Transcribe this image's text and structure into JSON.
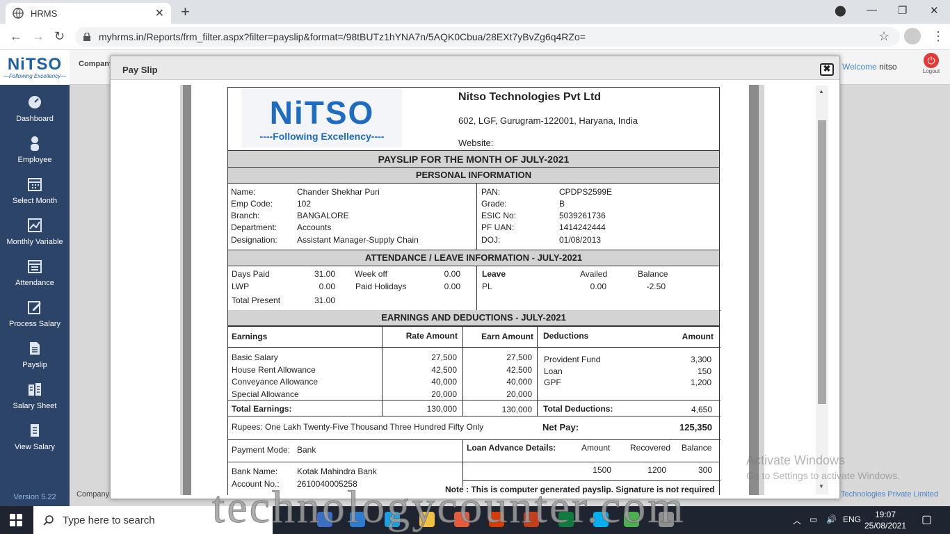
{
  "browser": {
    "tab_title": "HRMS",
    "url": "myhrms.in/Reports/frm_filter.aspx?filter=payslip&format=/98tBUTz1hYNA7n/5AQK0Cbua/28EXt7yBvZg6q4RZo="
  },
  "header": {
    "logo_text": "NiTSO",
    "logo_sub": "—Following Excellency—",
    "company_label": "Company",
    "welcome_label": "Welcome",
    "welcome_user": "nitso",
    "logout_label": "Logout"
  },
  "sidebar": {
    "items": [
      {
        "label": "Dashboard",
        "icon": "dashboard-icon"
      },
      {
        "label": "Employee",
        "icon": "employee-icon"
      },
      {
        "label": "Select Month",
        "icon": "calendar-icon"
      },
      {
        "label": "Monthly Variable",
        "icon": "chart-icon"
      },
      {
        "label": "Attendance",
        "icon": "attendance-icon"
      },
      {
        "label": "Process Salary",
        "icon": "edit-icon"
      },
      {
        "label": "Payslip",
        "icon": "document-icon"
      },
      {
        "label": "Salary Sheet",
        "icon": "sheet-icon"
      },
      {
        "label": "View Salary",
        "icon": "view-icon"
      }
    ],
    "version": "Version 5.22"
  },
  "footer": {
    "left": "Company",
    "right": "o Technologies Private Limited"
  },
  "modal": {
    "title": "Pay Slip",
    "close": "✖"
  },
  "payslip": {
    "logo_text": "NiTSO",
    "logo_sub": "----Following Excellency----",
    "company_name": "Nitso Technologies Pvt Ltd",
    "address": "602, LGF, Gurugram-122001, Haryana, India",
    "website": "Website:",
    "title": "PAYSLIP FOR THE MONTH OF JULY-2021",
    "personal_heading": "PERSONAL INFORMATION",
    "personal_left": [
      {
        "k": "Name:",
        "v": "Chander Shekhar Puri"
      },
      {
        "k": "Emp Code:",
        "v": "102"
      },
      {
        "k": "Branch:",
        "v": "BANGALORE"
      },
      {
        "k": "Department:",
        "v": "Accounts"
      },
      {
        "k": "Designation:",
        "v": "Assistant Manager-Supply Chain"
      }
    ],
    "personal_right": [
      {
        "k": "PAN:",
        "v": "CPDPS2599E"
      },
      {
        "k": "Grade:",
        "v": "B"
      },
      {
        "k": "ESIC No:",
        "v": "5039261736"
      },
      {
        "k": "PF UAN:",
        "v": "1414242444"
      },
      {
        "k": "DOJ:",
        "v": "01/08/2013"
      }
    ],
    "attendance_heading": "ATTENDANCE / LEAVE INFORMATION - JULY-2021",
    "attendance": {
      "days_paid_label": "Days Paid",
      "days_paid": "31.00",
      "week_off_label": "Week off",
      "week_off": "0.00",
      "lwp_label": "LWP",
      "lwp": "0.00",
      "paid_holidays_label": "Paid Holidays",
      "paid_holidays": "0.00",
      "total_present_label": "Total Present",
      "total_present": "31.00"
    },
    "leave": {
      "col_leave": "Leave",
      "col_availed": "Availed",
      "col_balance": "Balance",
      "type": "PL",
      "availed": "0.00",
      "balance": "-2.50"
    },
    "earnings_heading": "EARNINGS AND DEDUCTIONS - JULY-2021",
    "earn_cols": {
      "earnings": "Earnings",
      "rate": "Rate Amount",
      "earn": "Earn Amount",
      "deductions": "Deductions",
      "amount": "Amount"
    },
    "earnings": [
      {
        "name": "Basic Salary",
        "rate": "27,500",
        "earn": "27,500"
      },
      {
        "name": "House Rent Allowance",
        "rate": "42,500",
        "earn": "42,500"
      },
      {
        "name": "Conveyance Allowance",
        "rate": "40,000",
        "earn": "40,000"
      },
      {
        "name": "Special Allowance",
        "rate": "20,000",
        "earn": "20,000"
      }
    ],
    "deductions": [
      {
        "name": "Provident Fund",
        "amount": "3,300"
      },
      {
        "name": "Loan",
        "amount": "150"
      },
      {
        "name": "GPF",
        "amount": "1,200"
      }
    ],
    "totals": {
      "earnings_label": "Total Earnings:",
      "rate_total": "130,000",
      "earn_total": "130,000",
      "deductions_label": "Total Deductions:",
      "deductions_total": "4,650"
    },
    "words": "Rupees: One Lakh Twenty-Five Thousand Three Hundred Fifty Only",
    "net_pay_label": "Net Pay:",
    "net_pay": "125,350",
    "payment": [
      {
        "k": "Payment Mode:",
        "v": "Bank"
      },
      {
        "k": "Bank Name:",
        "v": "Kotak Mahindra Bank"
      },
      {
        "k": "Account No.:",
        "v": "2610040005258"
      }
    ],
    "loan": {
      "label": "Loan Advance Details:",
      "amount_label": "Amount",
      "recovered_label": "Recovered",
      "balance_label": "Balance",
      "amount": "1500",
      "recovered": "1200",
      "balance": "300"
    },
    "note": "Note : This is computer generated payslip. Signature is not required"
  },
  "watermark": {
    "windows_line1": "Activate Windows",
    "windows_line2": "Go to Settings to activate Windows.",
    "brand": "technologycounter.com"
  },
  "taskbar": {
    "search_placeholder": "Type here to search",
    "lang": "ENG",
    "time": "19:07",
    "date": "25/08/2021"
  },
  "colors": {
    "sidebar": "#2d4469",
    "brand_blue": "#1e6bc4",
    "band_gray": "#d3d3d3"
  }
}
